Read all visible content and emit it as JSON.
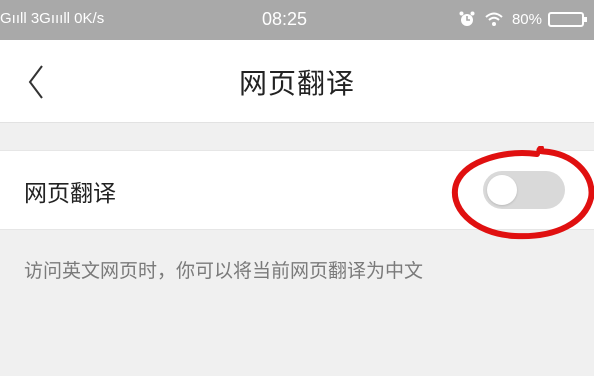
{
  "status_bar": {
    "left_text": "Gııll 3Gıııll 0K/s",
    "time": "08:25",
    "battery_text": "80%",
    "icons": [
      "alarm-icon",
      "wifi-icon",
      "battery-icon"
    ]
  },
  "header": {
    "title": "网页翻译",
    "back_icon": "chevron-left-icon"
  },
  "setting": {
    "label": "网页翻译",
    "toggle_state": "off",
    "annotation": "red-circle-highlight"
  },
  "description": "访问英文网页时，你可以将当前网页翻译为中文",
  "colors": {
    "status_bar": "#a9a9a9",
    "page_bg": "#f0f0f0",
    "row_bg": "#ffffff",
    "toggle_off": "#d9d9d9",
    "annotation": "#e01010"
  }
}
